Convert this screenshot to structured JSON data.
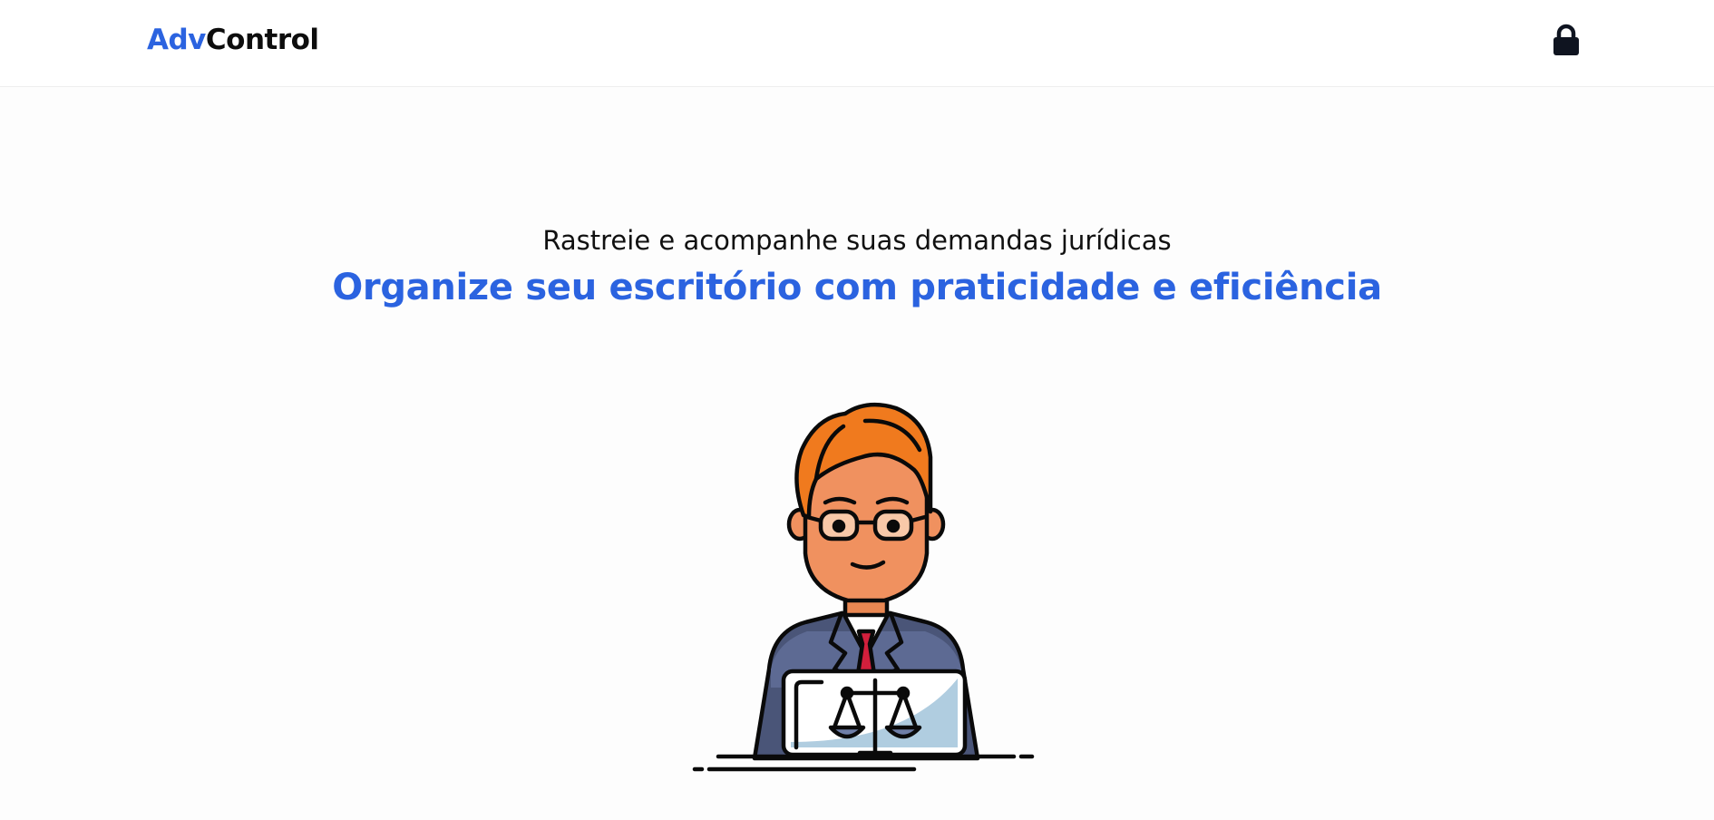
{
  "header": {
    "logo": {
      "accent_text": "Adv",
      "main_text": "Control"
    },
    "lock_icon": "lock-icon"
  },
  "hero": {
    "subtitle": "Rastreie e acompanhe suas demandas jurídicas",
    "headline": "Organize seu escritório com praticidade e eficiência",
    "illustration_icon": "lawyer-with-laptop-illustration"
  },
  "colors": {
    "accent": "#2b63e0",
    "text": "#111111",
    "background": "#fdfdfd",
    "hair": "#f07a1e",
    "skin": "#f0915f",
    "suit": "#4a5578",
    "tie": "#d21f3c",
    "screen": "#b0cde0"
  }
}
